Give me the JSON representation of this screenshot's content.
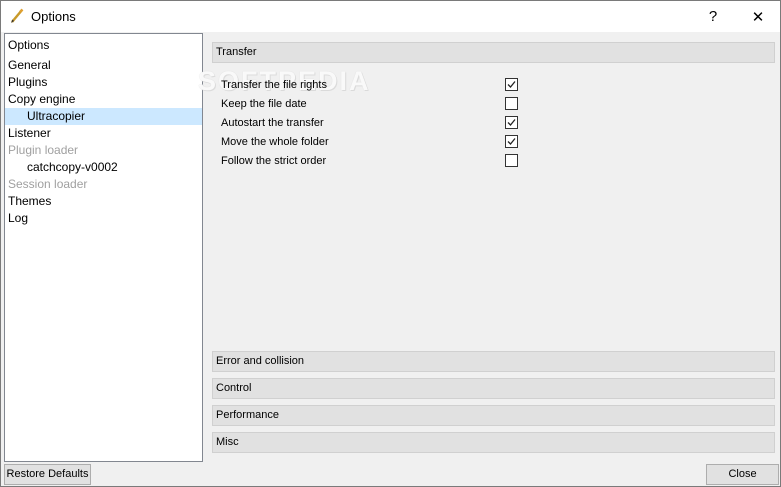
{
  "window": {
    "title": "Options",
    "help_glyph": "?",
    "close_glyph": "✕"
  },
  "tree": {
    "items": [
      {
        "label": "Options",
        "level": 1,
        "state": "normal"
      },
      {
        "label": "General",
        "level": 1,
        "state": "normal"
      },
      {
        "label": "Plugins",
        "level": 1,
        "state": "normal"
      },
      {
        "label": "Copy engine",
        "level": 1,
        "state": "normal"
      },
      {
        "label": "Ultracopier",
        "level": 2,
        "state": "selected"
      },
      {
        "label": "Listener",
        "level": 1,
        "state": "normal"
      },
      {
        "label": "Plugin loader",
        "level": 1,
        "state": "disabled"
      },
      {
        "label": "catchcopy-v0002",
        "level": 2,
        "state": "normal"
      },
      {
        "label": "Session loader",
        "level": 1,
        "state": "disabled"
      },
      {
        "label": "Themes",
        "level": 1,
        "state": "normal"
      },
      {
        "label": "Log",
        "level": 1,
        "state": "normal"
      }
    ]
  },
  "sections": {
    "transfer": "Transfer",
    "error_collision": "Error and collision",
    "control": "Control",
    "performance": "Performance",
    "misc": "Misc"
  },
  "transfer_options": [
    {
      "label": "Transfer the file rights",
      "checked": true
    },
    {
      "label": "Keep the file date",
      "checked": false
    },
    {
      "label": "Autostart the transfer",
      "checked": true
    },
    {
      "label": "Move the whole folder",
      "checked": true
    },
    {
      "label": "Follow the strict order",
      "checked": false
    }
  ],
  "watermark": "SOFTPEDIA",
  "buttons": {
    "restore_defaults": "Restore Defaults",
    "close": "Close"
  },
  "colors": {
    "selection": "#cce8ff",
    "disabled_text": "#a0a0a0"
  }
}
